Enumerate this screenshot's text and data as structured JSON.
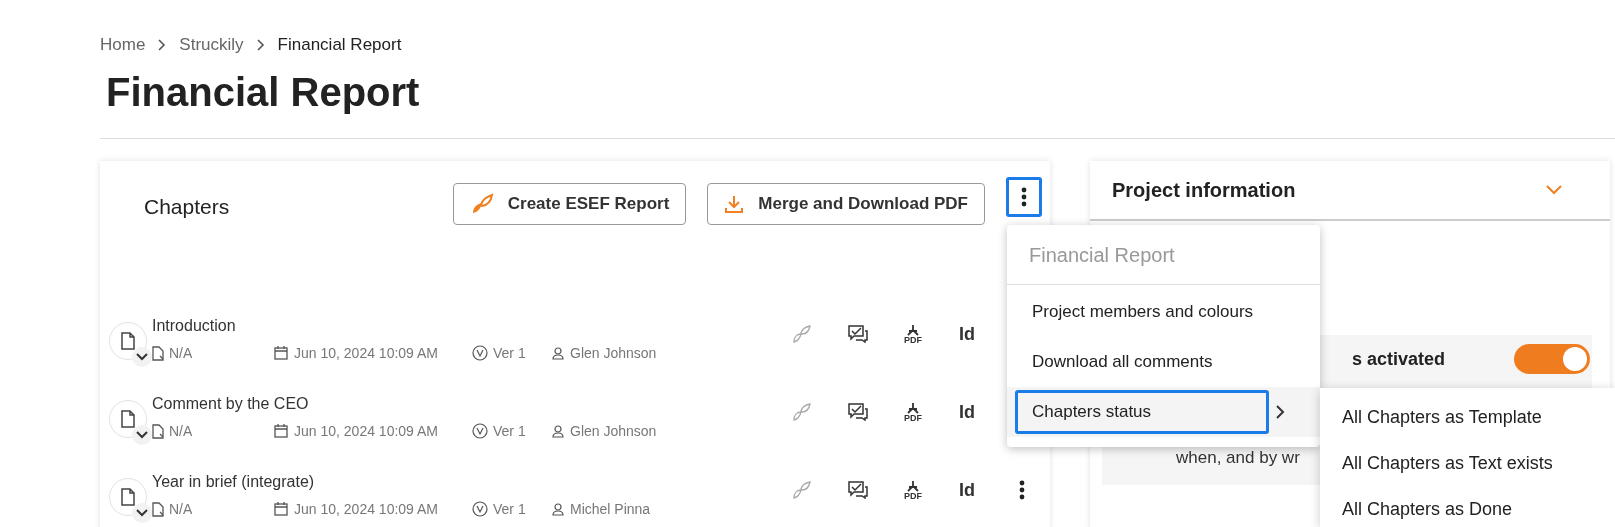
{
  "breadcrumb": [
    "Home",
    "Struckily",
    "Financial Report"
  ],
  "title": "Financial Report",
  "chapters_panel": {
    "title": "Chapters",
    "buttons": [
      {
        "label": "Create ESEF Report",
        "kind": "esef"
      },
      {
        "label": "Merge and Download PDF",
        "kind": "download"
      }
    ],
    "chapters": [
      {
        "name": "Introduction",
        "status": "N/A",
        "date": "Jun 10, 2024 10:09 AM",
        "version": "Ver 1",
        "author": "Glen Johnson",
        "pdf_label": "PDF",
        "id_label": "Id"
      },
      {
        "name": "Comment by the CEO",
        "status": "N/A",
        "date": "Jun 10, 2024 10:09 AM",
        "version": "Ver 1",
        "author": "Glen Johnson",
        "pdf_label": "PDF",
        "id_label": "Id"
      },
      {
        "name": "Year in brief (integrate)",
        "status": "N/A",
        "date": "Jun 10, 2024 10:09 AM",
        "version": "Ver 1",
        "author": "Michel Pinna",
        "pdf_label": "PDF",
        "id_label": "Id",
        "more_button": true
      }
    ]
  },
  "project_info": {
    "title": "Project information",
    "notice": {
      "title": "s activated",
      "on": true,
      "text": "when, and by wr"
    }
  },
  "menu": {
    "header": "Financial Report",
    "items": [
      {
        "label": "Project members and colours",
        "submenu": false,
        "selected": false
      },
      {
        "label": "Download all comments",
        "submenu": false,
        "selected": false
      },
      {
        "label": "Chapters status",
        "submenu": true,
        "selected": true
      }
    ],
    "submenu": [
      "All Chapters as Template",
      "All Chapters as Text exists",
      "All Chapters as Done"
    ]
  }
}
